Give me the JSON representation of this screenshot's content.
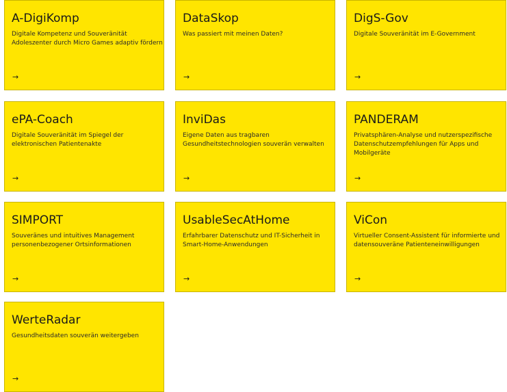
{
  "cards": [
    {
      "title": "A-DigiKomp",
      "description": "Digitale Kompetenz und Souveränität Adoleszenter durch Micro Games adaptiv fördern",
      "arrow": "→"
    },
    {
      "title": "DataSkop",
      "description": "Was passiert mit meinen Daten?",
      "arrow": "→"
    },
    {
      "title": "DigS-Gov",
      "description": "Digitale Souveränität im E-Government",
      "arrow": "→"
    },
    {
      "title": "ePA-Coach",
      "description": "Digitale Souveränität im Spiegel der elektronischen Patientenakte",
      "arrow": "→"
    },
    {
      "title": "InviDas",
      "description": "Eigene Daten aus tragbaren Gesundheitstechnologien souverän verwalten",
      "arrow": "→"
    },
    {
      "title": "PANDERAM",
      "description": "Privatsphären-Analyse und nutzerspezifische Datenschutzempfehlungen für Apps und Mobilgeräte",
      "arrow": "→"
    },
    {
      "title": "SIMPORT",
      "description": "Souveränes und intuitives Management personenbezogener Ortsinformationen",
      "arrow": "→"
    },
    {
      "title": "UsableSecAtHome",
      "description": "Erfahrbarer Datenschutz und IT-Sicherheit in Smart-Home-Anwendungen",
      "arrow": "→"
    },
    {
      "title": "ViCon",
      "description": "Virtueller Consent-Assistent für informierte und datensouveräne Patienteneinwilligungen",
      "arrow": "→"
    },
    {
      "title": "WerteRadar",
      "description": "Gesundheitsdaten souverän weitergeben",
      "arrow": "→"
    }
  ]
}
